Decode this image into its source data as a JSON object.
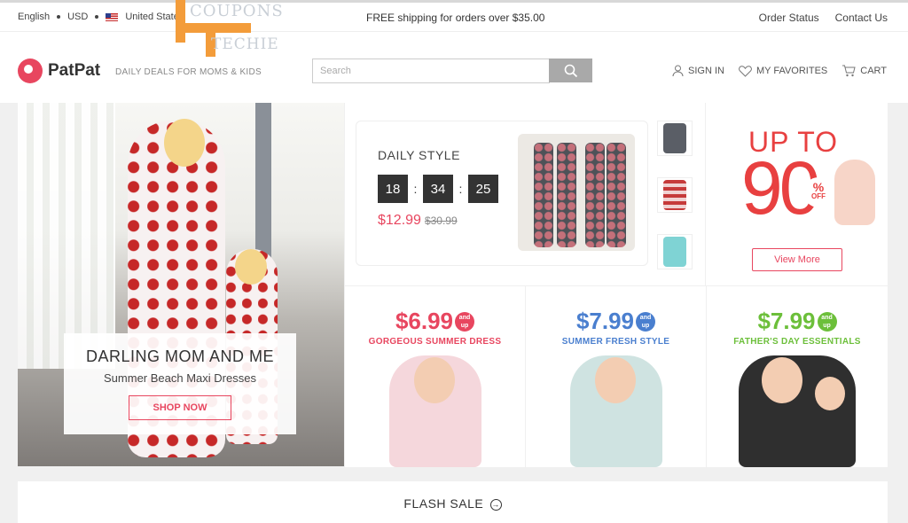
{
  "topbar": {
    "language": "English",
    "currency": "USD",
    "country": "United States",
    "shipping": "FREE shipping for orders over $35.00",
    "order_status": "Order Status",
    "contact_us": "Contact Us"
  },
  "watermark": {
    "line1": "COUPONS",
    "line2": "TECHIE"
  },
  "header": {
    "logo": "PatPat",
    "tagline": "DAILY DEALS FOR MOMS & KIDS",
    "search_placeholder": "Search",
    "sign_in": "SIGN IN",
    "favorites": "MY FAVORITES",
    "cart": "CART"
  },
  "hero": {
    "title": "DARLING MOM AND ME",
    "subtitle": "Summer Beach Maxi Dresses",
    "button": "SHOP NOW"
  },
  "daily": {
    "title": "DAILY STYLE",
    "hours": "18",
    "minutes": "34",
    "seconds": "25",
    "price": "$12.99",
    "old_price": "$30.99"
  },
  "promo90": {
    "line1": "UP TO",
    "number": "90",
    "pct": "%",
    "off": "OFF",
    "button": "View More"
  },
  "tiles": [
    {
      "price": "$6.99",
      "badge1": "and",
      "badge2": "up",
      "label": "GORGEOUS SUMMER DRESS",
      "color": "#e8465f"
    },
    {
      "price": "$7.99",
      "badge1": "and",
      "badge2": "up",
      "label": "SUMMER FRESH STYLE",
      "color": "#4a7fcf"
    },
    {
      "price": "$7.99",
      "badge1": "and",
      "badge2": "up",
      "label": "FATHER'S DAY ESSENTIALS",
      "color": "#6cbf3a"
    }
  ],
  "flash": {
    "label": "FLASH SALE",
    "arrow": "→"
  }
}
